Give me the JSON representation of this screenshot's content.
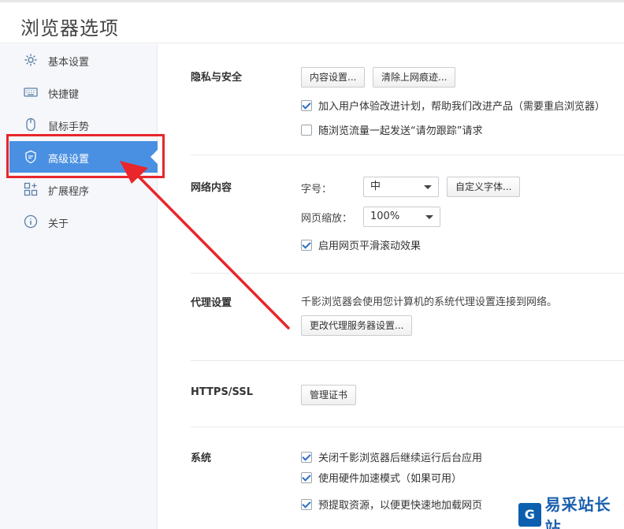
{
  "header": {
    "title": "浏览器选项"
  },
  "sidebar": {
    "items": [
      {
        "label": "基本设置",
        "icon": "gear-icon"
      },
      {
        "label": "快捷键",
        "icon": "keyboard-icon"
      },
      {
        "label": "鼠标手势",
        "icon": "mouse-icon"
      },
      {
        "label": "高级设置",
        "icon": "shield-icon",
        "active": true
      },
      {
        "label": "扩展程序",
        "icon": "extensions-icon"
      },
      {
        "label": "关于",
        "icon": "info-icon"
      }
    ]
  },
  "privacy": {
    "title": "隐私与安全",
    "content_settings": "内容设置...",
    "clear_history": "清除上网痕迹...",
    "improve_plan": "加入用户体验改进计划，帮助我们改进产品（需要重启浏览器）",
    "dnt": "随浏览流量一起发送“请勿跟踪”请求"
  },
  "web_content": {
    "title": "网络内容",
    "font_size_label": "字号：",
    "font_size_value": "中",
    "custom_font": "自定义字体...",
    "zoom_label": "网页缩放：",
    "zoom_value": "100%",
    "smooth_scroll": "启用网页平滑滚动效果"
  },
  "proxy": {
    "title": "代理设置",
    "desc": "千影浏览器会使用您计算机的系统代理设置连接到网络。",
    "change_proxy": "更改代理服务器设置..."
  },
  "https": {
    "title": "HTTPS/SSL",
    "manage_certs": "管理证书"
  },
  "system": {
    "title": "系统",
    "background_apps": "关闭千影浏览器后继续运行后台应用",
    "hardware_accel": "使用硬件加速模式（如果可用）",
    "prefetch": "预提取资源，以便更快速地加载网页"
  },
  "watermark": {
    "text": "易采站长站",
    "logo_letter": "G"
  },
  "colors": {
    "accent": "#4a90e2",
    "highlight": "#e8262b"
  }
}
